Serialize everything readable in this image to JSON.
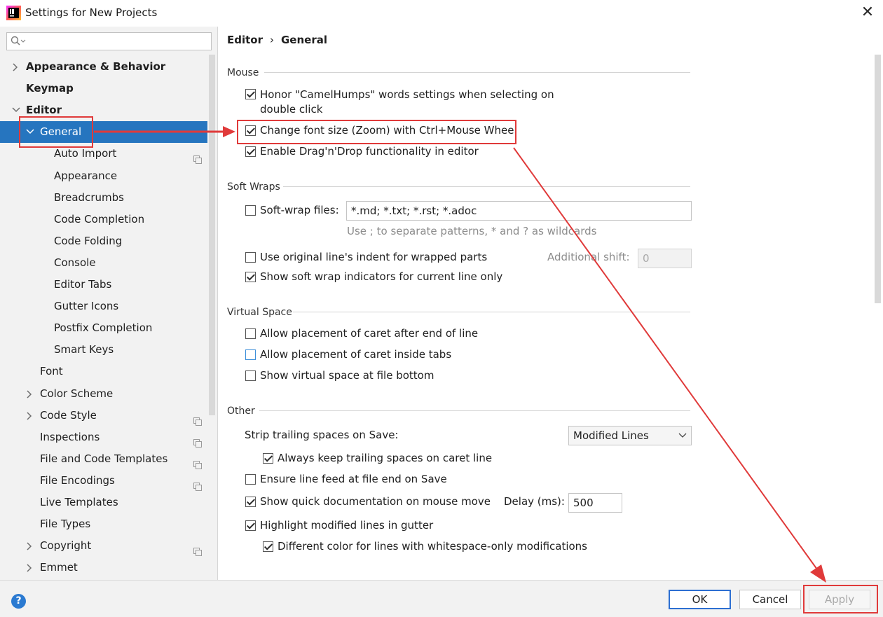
{
  "window": {
    "title": "Settings for New Projects"
  },
  "sidebar": {
    "search_placeholder": "",
    "items": [
      {
        "label": "Appearance & Behavior",
        "level": 0,
        "bold": true,
        "expander": "collapsed"
      },
      {
        "label": "Keymap",
        "level": 0,
        "bold": true,
        "expander": "none"
      },
      {
        "label": "Editor",
        "level": 0,
        "bold": true,
        "expander": "expanded"
      },
      {
        "label": "General",
        "level": 1,
        "bold": false,
        "expander": "expanded",
        "selected": true
      },
      {
        "label": "Auto Import",
        "level": 2,
        "copy_icon": true
      },
      {
        "label": "Appearance",
        "level": 2
      },
      {
        "label": "Breadcrumbs",
        "level": 2
      },
      {
        "label": "Code Completion",
        "level": 2
      },
      {
        "label": "Code Folding",
        "level": 2
      },
      {
        "label": "Console",
        "level": 2
      },
      {
        "label": "Editor Tabs",
        "level": 2
      },
      {
        "label": "Gutter Icons",
        "level": 2
      },
      {
        "label": "Postfix Completion",
        "level": 2
      },
      {
        "label": "Smart Keys",
        "level": 2
      },
      {
        "label": "Font",
        "level": 1
      },
      {
        "label": "Color Scheme",
        "level": 1,
        "expander": "collapsed"
      },
      {
        "label": "Code Style",
        "level": 1,
        "expander": "collapsed",
        "copy_icon": true
      },
      {
        "label": "Inspections",
        "level": 1,
        "copy_icon": true
      },
      {
        "label": "File and Code Templates",
        "level": 1,
        "copy_icon": true
      },
      {
        "label": "File Encodings",
        "level": 1,
        "copy_icon": true
      },
      {
        "label": "Live Templates",
        "level": 1
      },
      {
        "label": "File Types",
        "level": 1
      },
      {
        "label": "Copyright",
        "level": 1,
        "expander": "collapsed",
        "copy_icon": true
      },
      {
        "label": "Emmet",
        "level": 1,
        "expander": "collapsed"
      }
    ]
  },
  "breadcrumb": {
    "parent": "Editor",
    "separator": "›",
    "current": "General"
  },
  "mouse": {
    "header": "Mouse",
    "camelhumps_line1": "Honor \"CamelHumps\" words settings when selecting on",
    "camelhumps_line2": "double click",
    "camelhumps_checked": true,
    "zoom": "Change font size (Zoom) with Ctrl+Mouse Wheel",
    "zoom_checked": true,
    "dragdrop": "Enable Drag'n'Drop functionality in editor",
    "dragdrop_checked": true
  },
  "soft_wraps": {
    "header": "Soft Wraps",
    "files_label": "Soft-wrap files:",
    "files_checked": false,
    "files_value": "*.md; *.txt; *.rst; *.adoc",
    "files_hint": "Use ; to separate patterns, * and ? as wildcards",
    "indent_label": "Use original line's indent for wrapped parts",
    "indent_checked": false,
    "shift_label": "Additional shift:",
    "shift_value": "0",
    "indicators_label": "Show soft wrap indicators for current line only",
    "indicators_checked": true
  },
  "virtual_space": {
    "header": "Virtual Space",
    "after_end": "Allow placement of caret after end of line",
    "after_end_checked": false,
    "inside_tabs": "Allow placement of caret inside tabs",
    "inside_tabs_checked": false,
    "file_bottom": "Show virtual space at file bottom",
    "file_bottom_checked": false
  },
  "other": {
    "header": "Other",
    "strip_label": "Strip trailing spaces on Save:",
    "strip_value": "Modified Lines",
    "keep_trailing": "Always keep trailing spaces on caret line",
    "keep_trailing_checked": true,
    "line_feed": "Ensure line feed at file end on Save",
    "line_feed_checked": false,
    "quick_doc": "Show quick documentation on mouse move",
    "quick_doc_checked": true,
    "delay_label": "Delay (ms):",
    "delay_value": "500",
    "highlight_modified": "Highlight modified lines in gutter",
    "highlight_modified_checked": true,
    "different_color": "Different color for lines with whitespace-only modifications",
    "different_color_checked": true
  },
  "buttons": {
    "ok": "OK",
    "cancel": "Cancel",
    "apply": "Apply",
    "help": "?"
  },
  "colors": {
    "accent": "#2675bf",
    "annotation": "#e03a3a",
    "ok_border": "#2d6fd2"
  }
}
